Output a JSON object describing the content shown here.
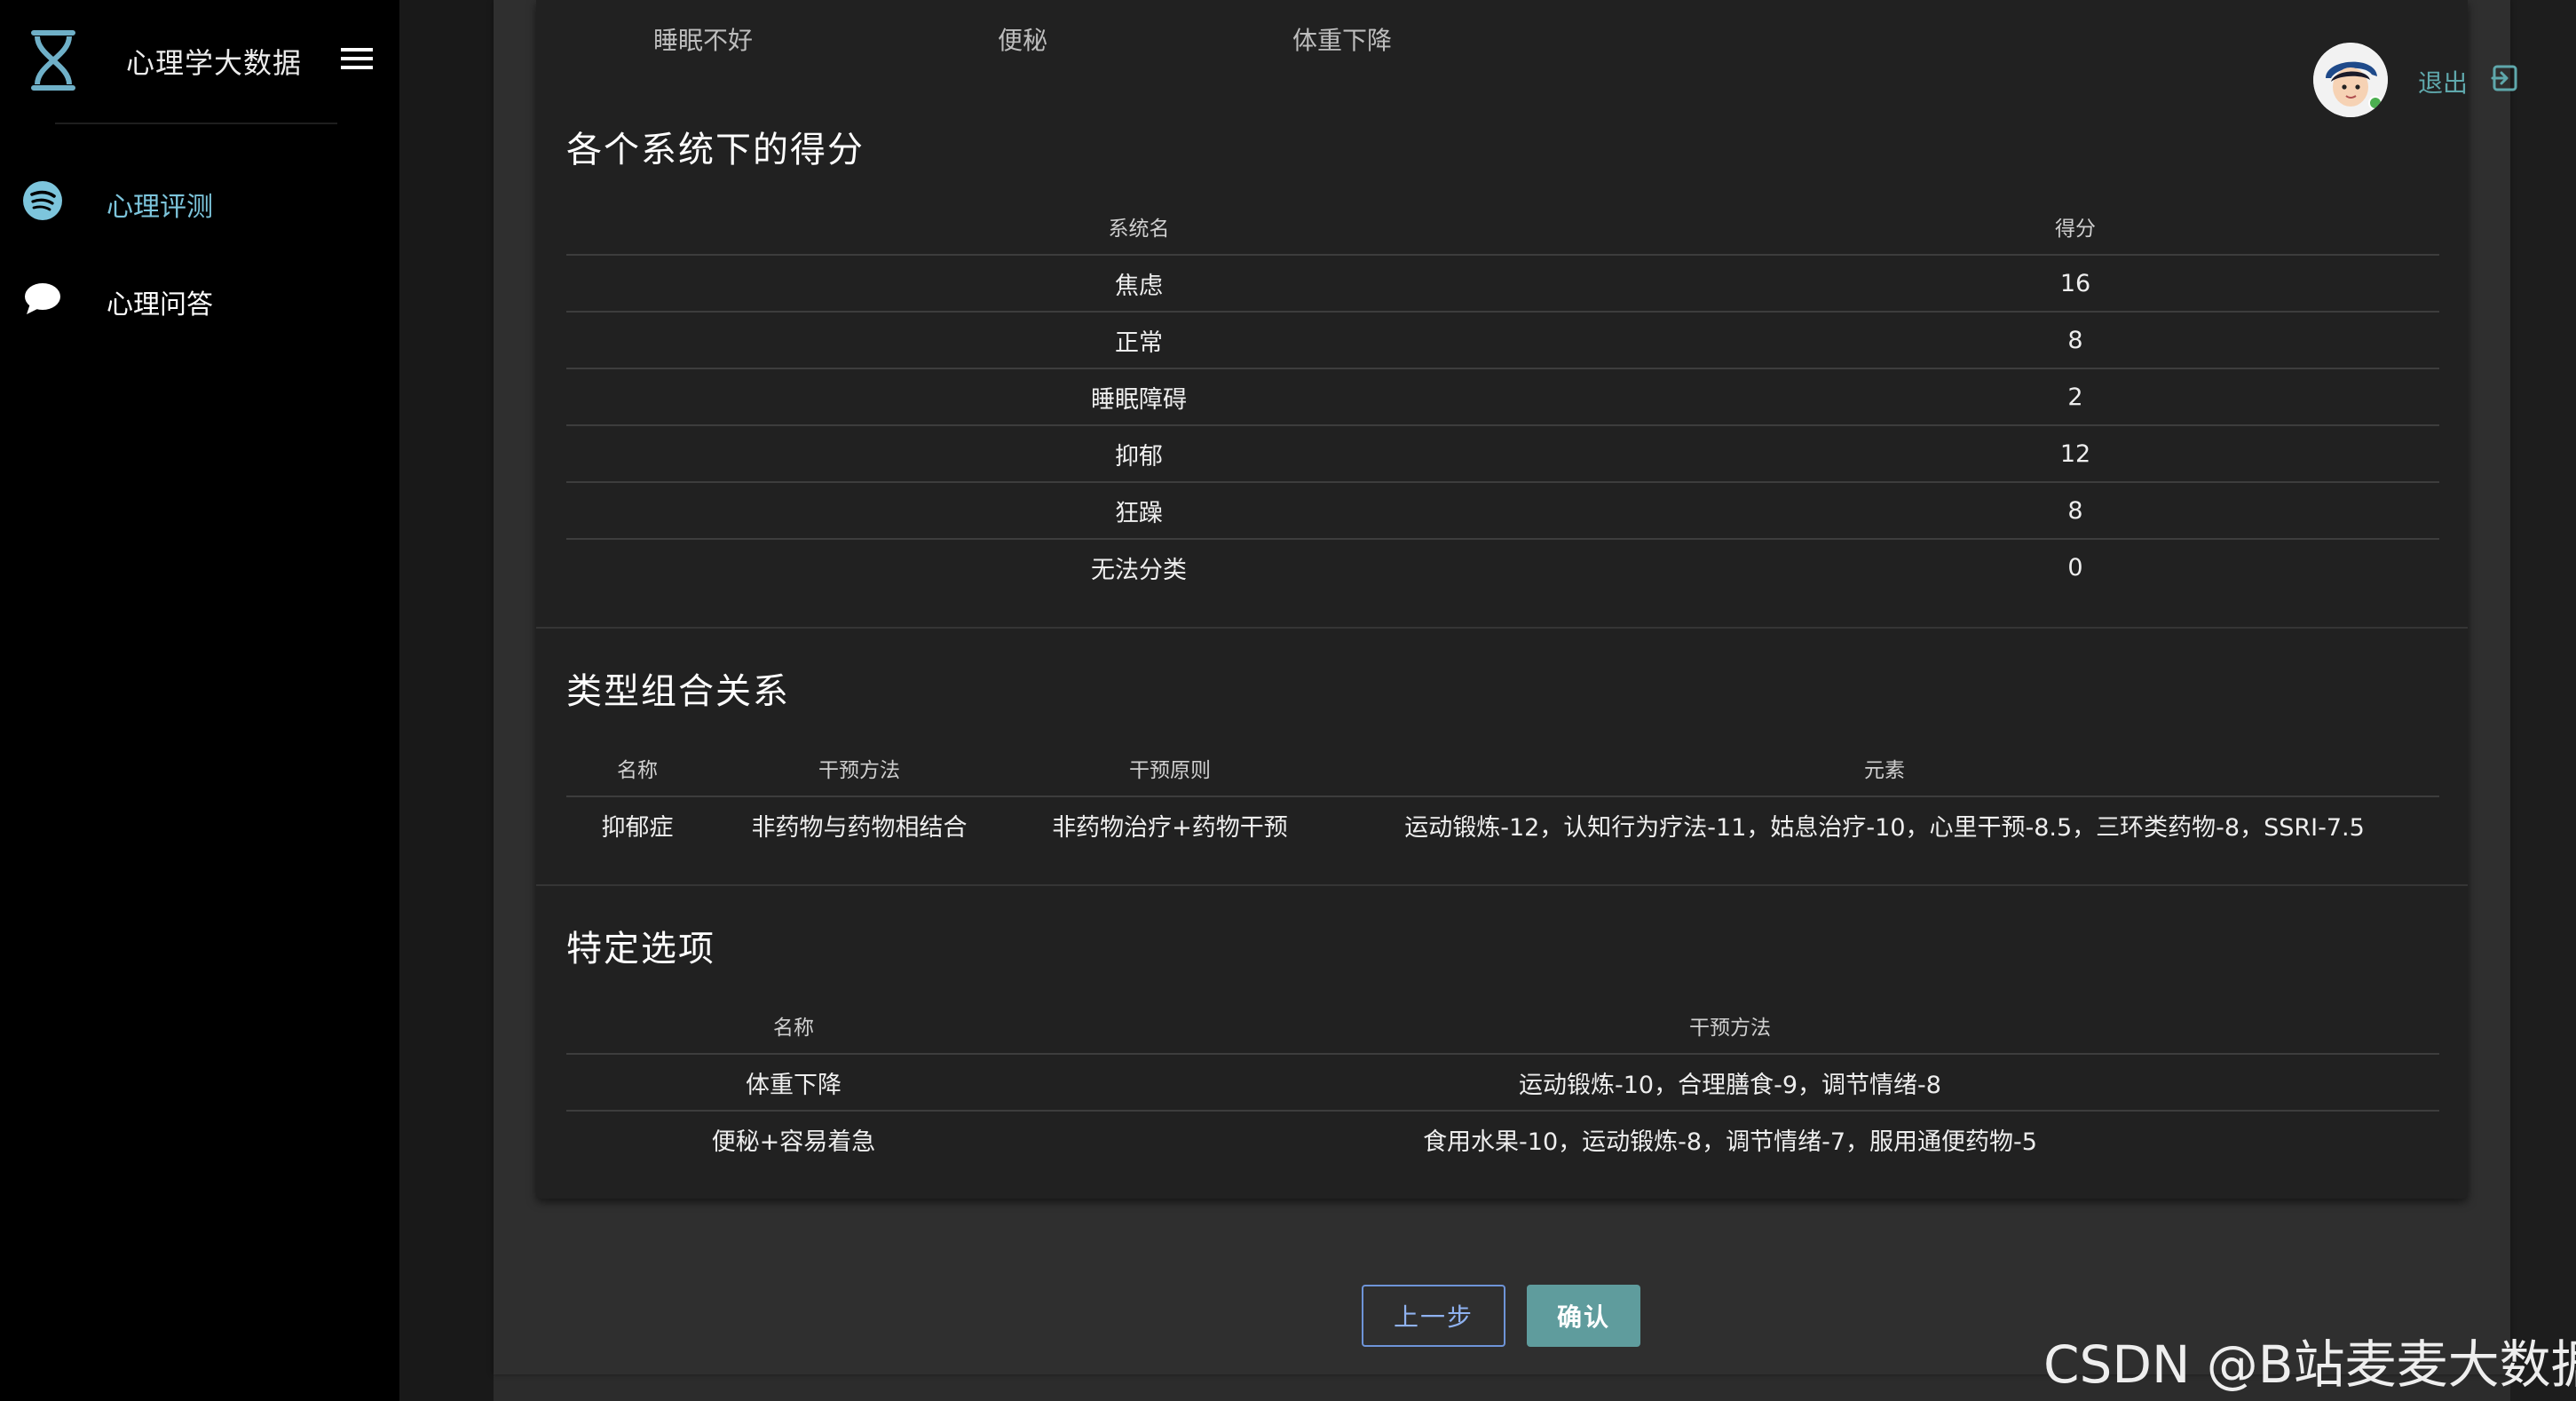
{
  "app": {
    "title": "心理学大数据",
    "colors": {
      "accent": "#7dc5dc",
      "primary_button": "#5f9c9d",
      "sidebar_bg": "#000000",
      "card_bg": "#212121"
    }
  },
  "sidebar": {
    "items": [
      {
        "label": "心理评测",
        "icon": "spotify-like-icon",
        "active": true
      },
      {
        "label": "心理问答",
        "icon": "chat-bubble-icon",
        "active": false
      }
    ]
  },
  "header": {
    "logout_label": "退出"
  },
  "symptoms": [
    "睡眠不好",
    "便秘",
    "体重下降"
  ],
  "system_scores": {
    "title": "各个系统下的得分",
    "columns": [
      "系统名",
      "得分"
    ],
    "rows": [
      [
        "焦虑",
        "16"
      ],
      [
        "正常",
        "8"
      ],
      [
        "睡眠障碍",
        "2"
      ],
      [
        "抑郁",
        "12"
      ],
      [
        "狂躁",
        "8"
      ],
      [
        "无法分类",
        "0"
      ]
    ]
  },
  "type_combination": {
    "title": "类型组合关系",
    "columns": [
      "名称",
      "干预方法",
      "干预原则",
      "元素"
    ],
    "rows": [
      [
        "抑郁症",
        "非药物与药物相结合",
        "非药物治疗+药物干预",
        "运动锻炼-12，认知行为疗法-11，姑息治疗-10，心里干预-8.5，三环类药物-8，SSRI-7.5"
      ]
    ]
  },
  "specific_options": {
    "title": "特定选项",
    "columns": [
      "名称",
      "干预方法"
    ],
    "rows": [
      [
        "体重下降",
        "运动锻炼-10，合理膳食-9，调节情绪-8"
      ],
      [
        "便秘+容易着急",
        "食用水果-10，运动锻炼-8，调节情绪-7，服用通便药物-5"
      ]
    ]
  },
  "actions": {
    "prev_label": "上一步",
    "confirm_label": "确认"
  },
  "watermark": "CSDN @B站麦麦大数据"
}
